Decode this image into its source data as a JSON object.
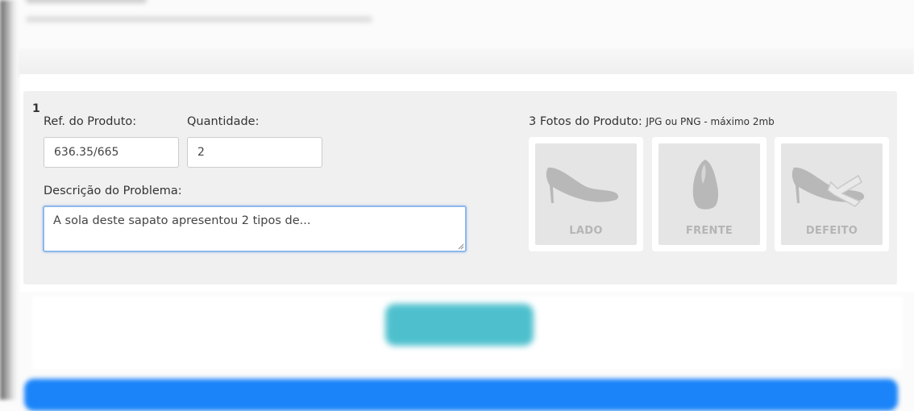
{
  "item": {
    "number": "1",
    "ref_label": "Ref. do Produto:",
    "ref_value": "636.35/665",
    "qty_label": "Quantidade:",
    "qty_value": "2",
    "desc_label": "Descrição do Problema:",
    "desc_value": "A sola deste sapato apresentou 2 tipos de..."
  },
  "photos": {
    "label": "3 Fotos do Produto:",
    "hint": "JPG ou PNG - máximo 2mb",
    "items": [
      {
        "caption": "LADO",
        "icon": "shoe-side-icon"
      },
      {
        "caption": "FRENTE",
        "icon": "shoe-front-icon"
      },
      {
        "caption": "DEFEITO",
        "icon": "shoe-defect-icon"
      }
    ]
  },
  "colors": {
    "panel_bg": "#f0f0f0",
    "focus_border": "#8fb8ec",
    "teal_button": "#4ec0cd",
    "blue_button": "#1b84f8",
    "photo_caption": "#b5b5b5"
  }
}
